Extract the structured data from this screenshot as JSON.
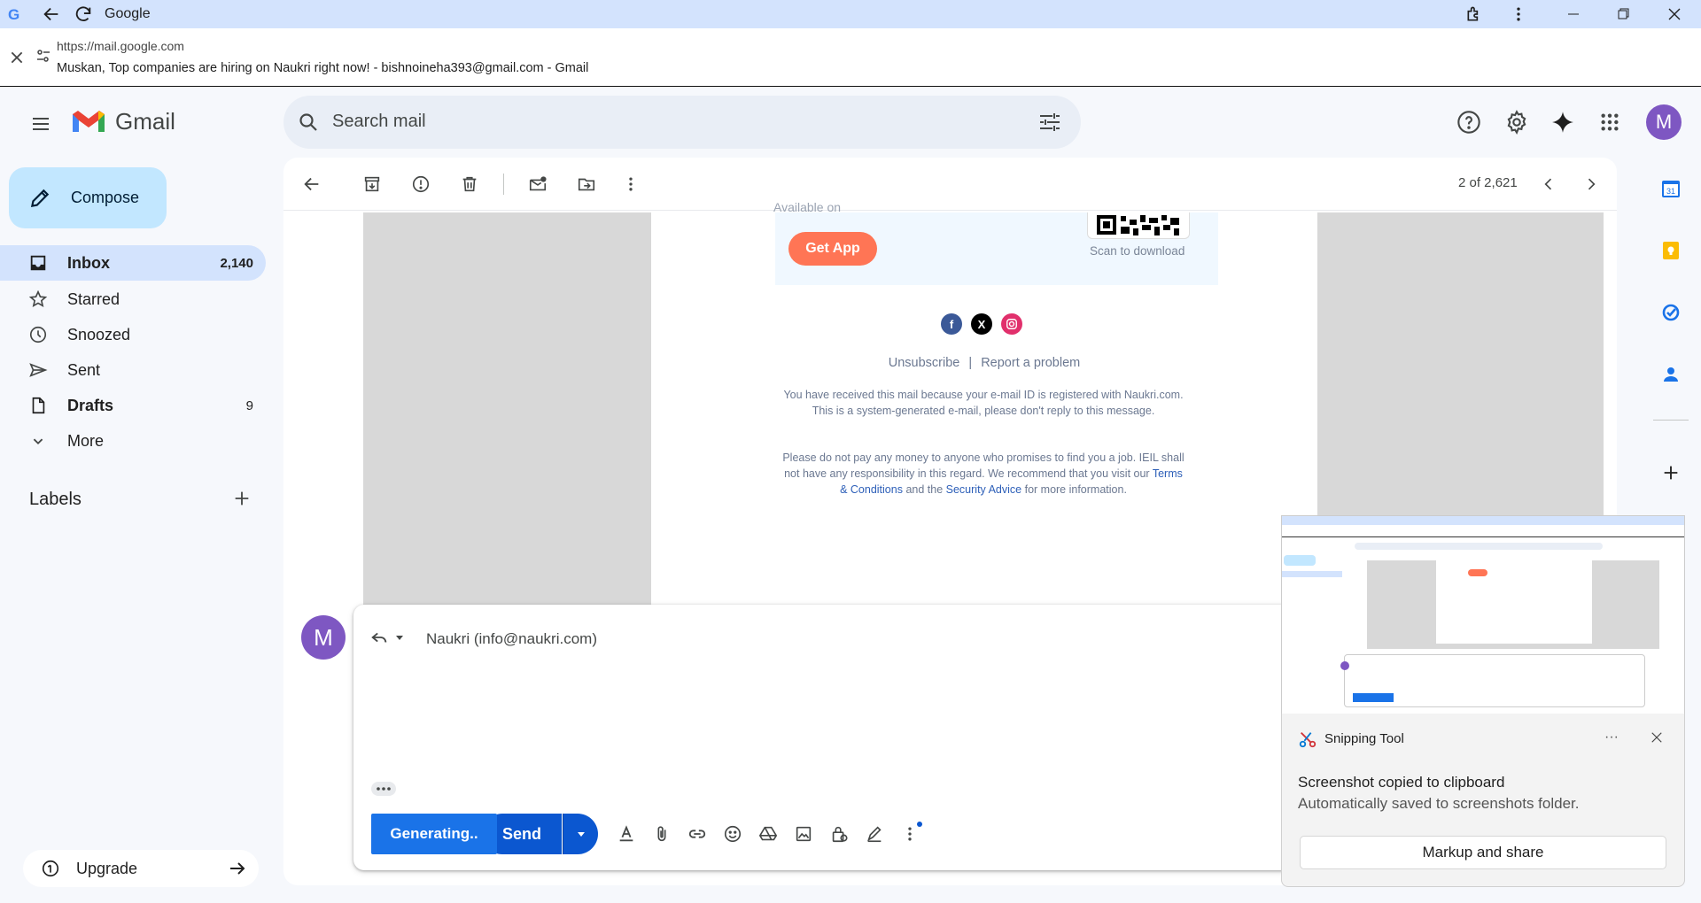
{
  "window": {
    "title": "Google"
  },
  "address": {
    "url": "https://mail.google.com",
    "page_title": "Muskan, Top companies are hiring on Naukri right now! - bishnoineha393@gmail.com - Gmail"
  },
  "header": {
    "logo_text": "Gmail",
    "search_placeholder": "Search mail",
    "avatar_letter": "M"
  },
  "sidebar": {
    "compose_label": "Compose",
    "items": [
      {
        "label": "Inbox",
        "count": "2,140",
        "icon": "inbox-icon"
      },
      {
        "label": "Starred",
        "count": "",
        "icon": "star-icon"
      },
      {
        "label": "Snoozed",
        "count": "",
        "icon": "clock-icon"
      },
      {
        "label": "Sent",
        "count": "",
        "icon": "send-icon"
      },
      {
        "label": "Drafts",
        "count": "9",
        "icon": "draft-icon"
      },
      {
        "label": "More",
        "count": "",
        "icon": "chevron-down-icon"
      }
    ],
    "labels_heading": "Labels",
    "upgrade_label": "Upgrade"
  },
  "toolbar": {
    "pager": "2 of 2,621"
  },
  "email": {
    "available_on": "Available on",
    "get_app": "Get App",
    "scan_to_download": "Scan to download",
    "unsubscribe": "Unsubscribe",
    "separator": "|",
    "report": "Report a problem",
    "notice1": "You have received this mail because your e-mail ID is registered with Naukri.com. This is a system-generated e-mail, please don't reply to this message.",
    "notice2_pre": "Please do not pay any money to anyone who promises to find you a job. IEIL shall not have any responsibility in this regard. We recommend that you visit our",
    "terms": "Terms & Conditions",
    "and_the": "and the",
    "security": "Security Advice",
    "notice2_post": "for more information."
  },
  "reply": {
    "avatar_letter": "M",
    "to": "Naukri (info@naukri.com)",
    "generating_label": "Generating..",
    "send_label": "Send"
  },
  "toast": {
    "app_name": "Snipping Tool",
    "more": "···",
    "heading": "Screenshot copied to clipboard",
    "subtext": "Automatically saved to screenshots folder.",
    "action": "Markup and share"
  },
  "colors": {
    "accent": "#0b57d0",
    "inbox_active": "#d3e3fd",
    "compose_bg": "#c2e7ff",
    "avatar": "#7e57c2",
    "get_app": "#ff7555"
  }
}
